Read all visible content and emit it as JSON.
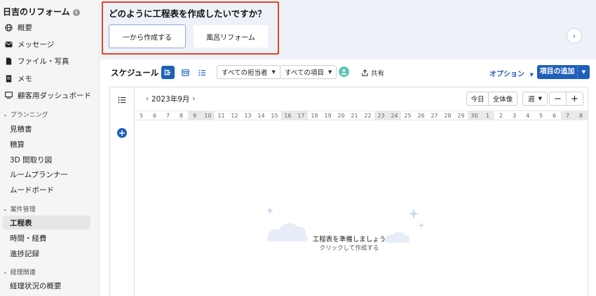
{
  "sidebar": {
    "project_title": "日吉のリフォーム",
    "info_glyph": "i",
    "top_items": [
      {
        "label": "概要",
        "icon": "globe-icon"
      },
      {
        "label": "メッセージ",
        "icon": "mail-icon"
      },
      {
        "label": "ファイル・写真",
        "icon": "file-icon"
      },
      {
        "label": "メモ",
        "icon": "memo-icon"
      },
      {
        "label": "顧客用ダッシュボード",
        "icon": "dashboard-icon"
      }
    ],
    "sections": [
      {
        "label": "プランニング",
        "items": [
          "見積書",
          "積算",
          "3D 間取り図",
          "ルームプランナー",
          "ムードボード"
        ]
      },
      {
        "label": "案件管理",
        "items": [
          "工程表",
          "時間・経費",
          "進捗記録"
        ]
      },
      {
        "label": "経理関連",
        "items": [
          "経理状況の概要"
        ]
      }
    ],
    "active_item": "工程表"
  },
  "banner": {
    "question": "どのように工程表を作成したいですか？",
    "options": [
      "一から作成する",
      "風呂リフォーム"
    ],
    "next_glyph": "›"
  },
  "toolbar": {
    "schedule_label": "スケジュール",
    "assignee_filter": "すべての担当者",
    "item_filter": "すべての項目",
    "share_label": "共有",
    "options_label": "オプション",
    "add_item_label": "項目の追加",
    "caret": "▼"
  },
  "gantt": {
    "month_label": "2023年9月",
    "prev_glyph": "‹",
    "next_glyph": "›",
    "today_label": "今日",
    "overview_label": "全体像",
    "period_label": "週",
    "zoom_out": "−",
    "zoom_in": "+",
    "days": [
      "5",
      "6",
      "7",
      "8",
      "9",
      "10",
      "11",
      "12",
      "13",
      "14",
      "15",
      "16",
      "17",
      "18",
      "19",
      "20",
      "21",
      "22",
      "23",
      "24",
      "25",
      "26",
      "27",
      "28",
      "29",
      "30",
      "1",
      "2",
      "3",
      "4",
      "5",
      "6",
      "7",
      "8"
    ],
    "weekend_indices": [
      4,
      5,
      11,
      12,
      18,
      19,
      25,
      26,
      32,
      33
    ],
    "empty_title": "工程表を準備しましょう",
    "empty_subtitle": "クリックして作成する"
  },
  "colors": {
    "accent": "#1f5fb8",
    "highlight_border": "#e2452b",
    "avatar": "#64c6b5"
  }
}
